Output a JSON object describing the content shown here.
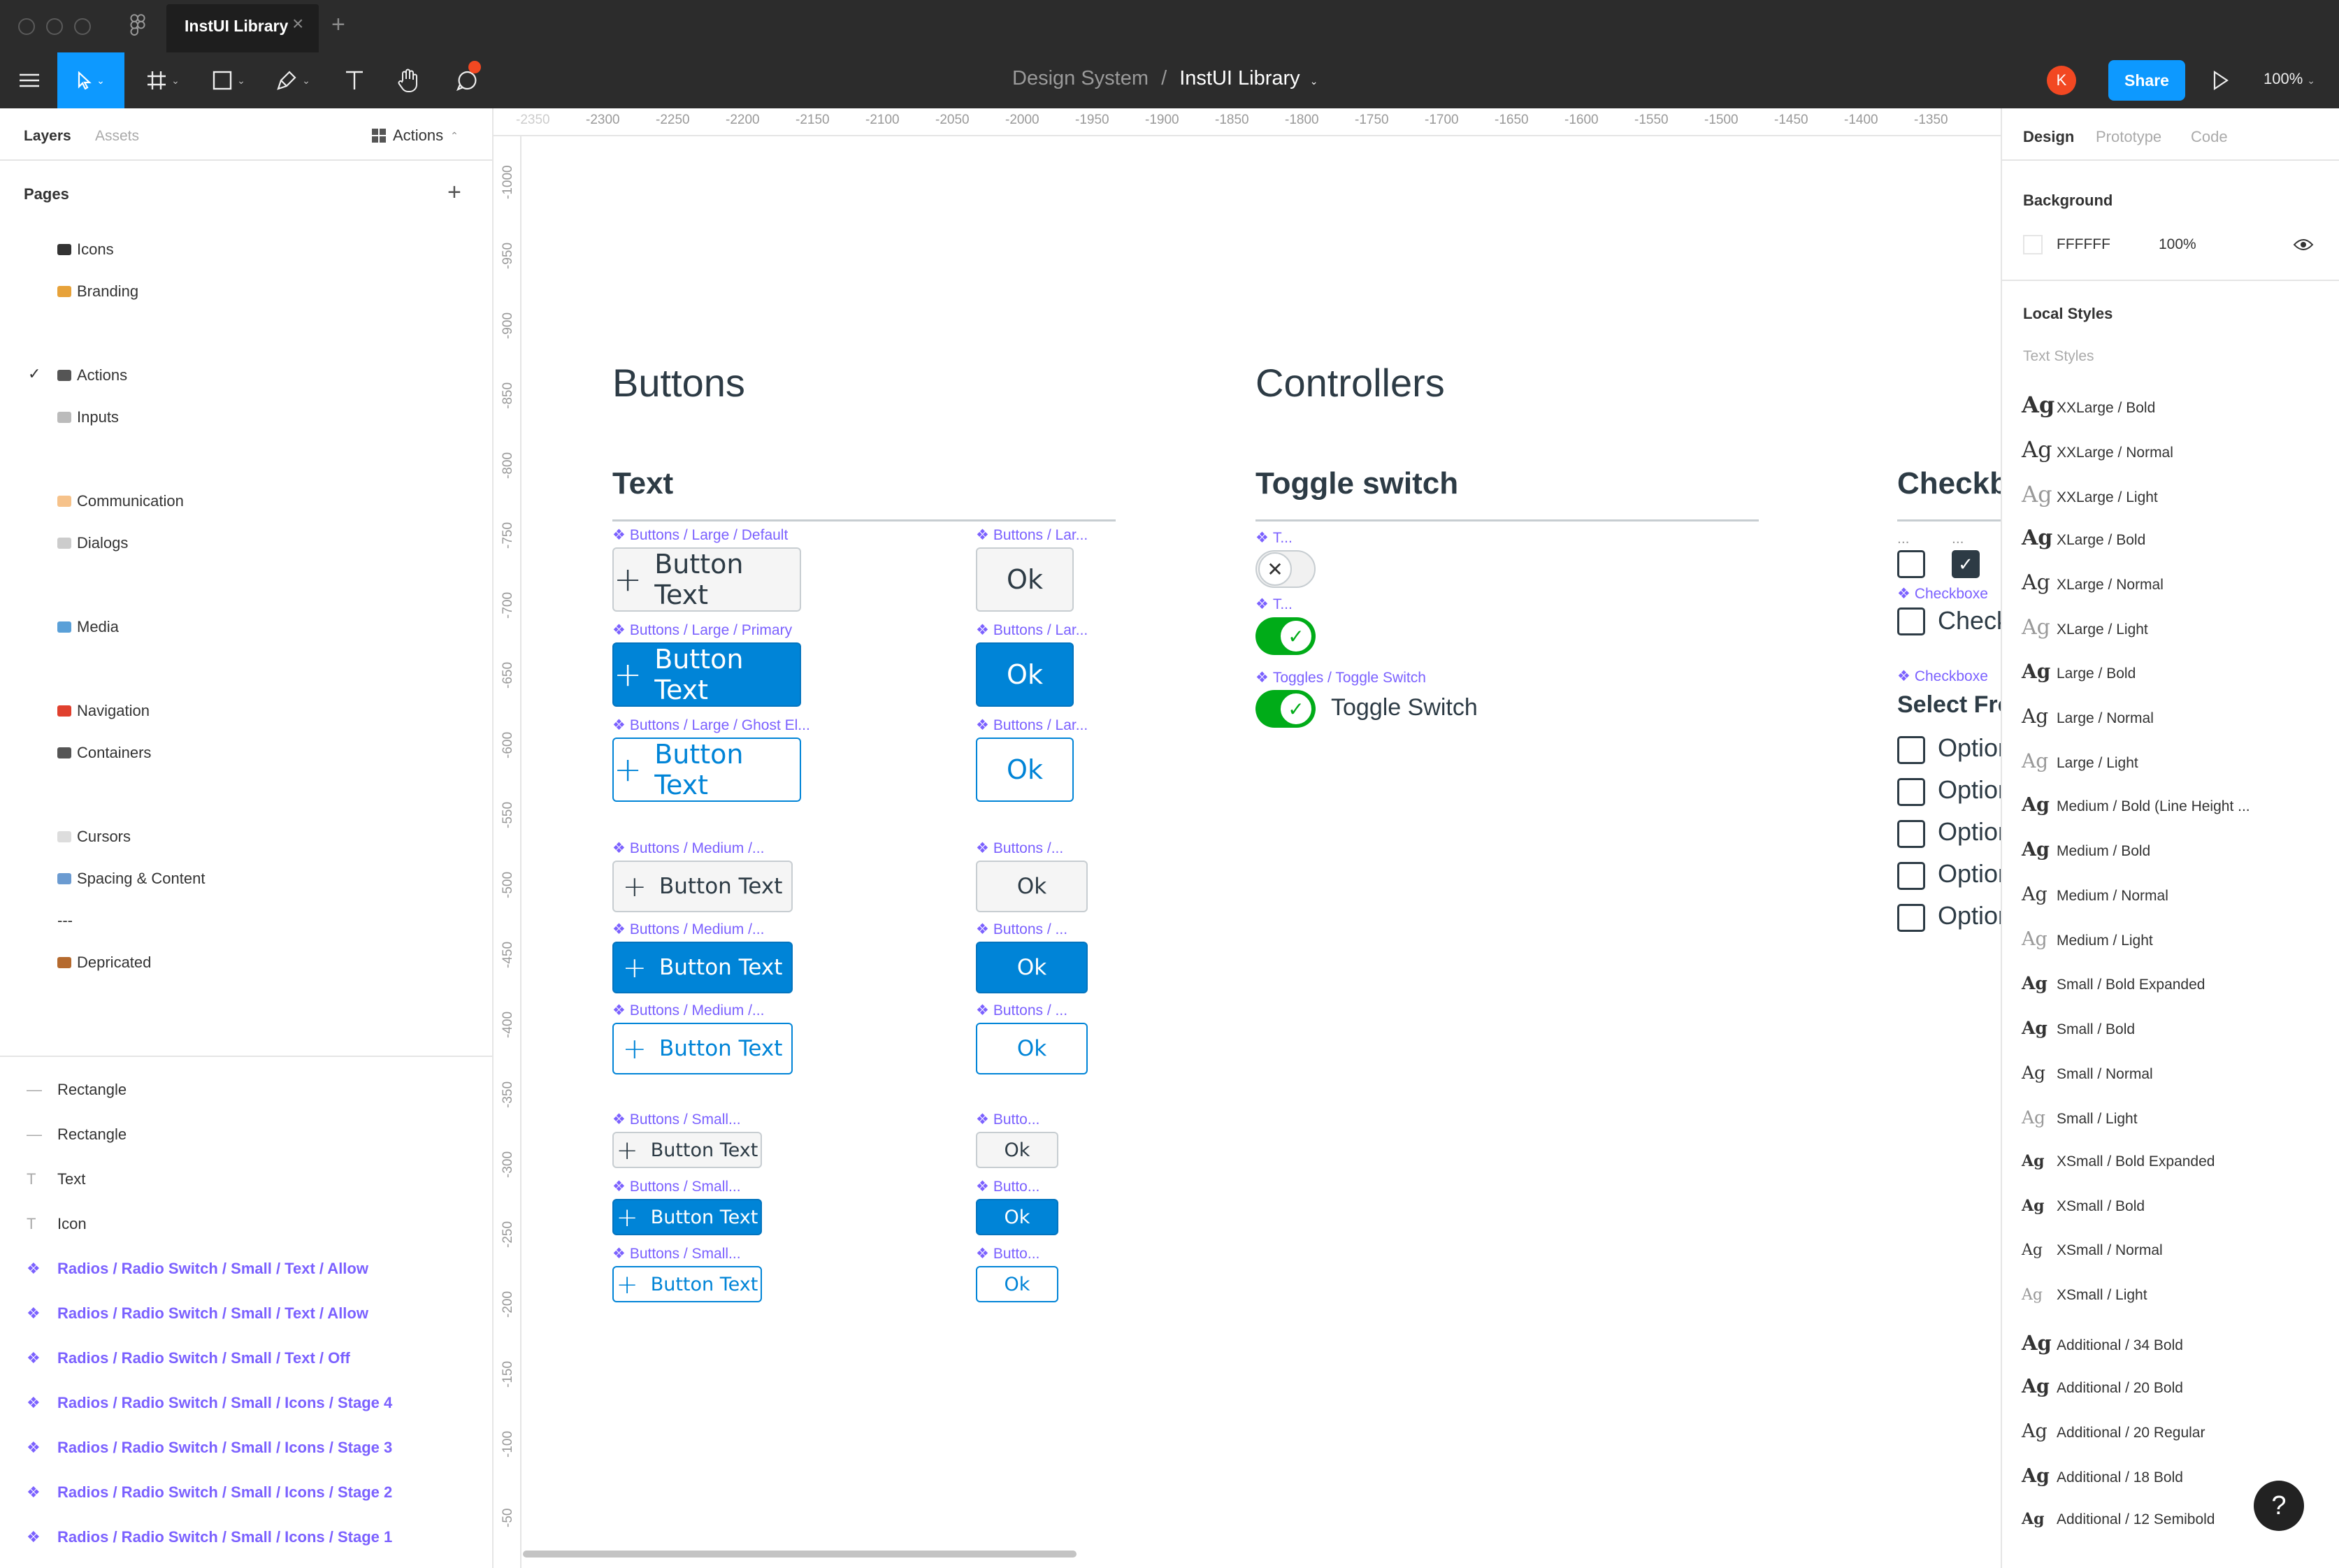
{
  "window": {
    "tab_title": "InstUI Library"
  },
  "toolbar": {
    "breadcrumb_parent": "Design System",
    "breadcrumb_sep": "/",
    "breadcrumb_current": "InstUI Library",
    "avatar_initial": "K",
    "share_label": "Share",
    "zoom": "100%"
  },
  "left_panel": {
    "tabs": {
      "layers": "Layers",
      "assets": "Assets"
    },
    "current_page_dropdown": "Actions",
    "pages_title": "Pages",
    "pages": [
      {
        "label": "Icons",
        "icon": "person-icon",
        "selected": false
      },
      {
        "label": "Branding",
        "icon": "paint-icon",
        "selected": false
      },
      {
        "label": "Actions",
        "icon": "grid-icon",
        "selected": true
      },
      {
        "label": "Inputs",
        "icon": "keyboard-icon",
        "selected": false
      },
      {
        "label": "Communication",
        "icon": "bubble-icon",
        "selected": false
      },
      {
        "label": "Dialogs",
        "icon": "speech-icon",
        "selected": false
      },
      {
        "label": "Media",
        "icon": "image-icon",
        "selected": false
      },
      {
        "label": "Navigation",
        "icon": "pin-icon",
        "selected": false
      },
      {
        "label": "Containers",
        "icon": "box-icon",
        "selected": false
      },
      {
        "label": "Cursors",
        "icon": "cursor-icon",
        "selected": false
      },
      {
        "label": "Spacing & Content",
        "icon": "ruler-icon",
        "selected": false
      },
      {
        "label": "---",
        "icon": "",
        "selected": false
      },
      {
        "label": "Depricated",
        "icon": "house-icon",
        "selected": false
      }
    ],
    "layers": [
      {
        "label": "Rectangle",
        "type": "line"
      },
      {
        "label": "Rectangle",
        "type": "line"
      },
      {
        "label": "Text",
        "type": "text"
      },
      {
        "label": "Icon",
        "type": "text"
      },
      {
        "label": "Radios / Radio Switch / Small / Text / Allow",
        "type": "component"
      },
      {
        "label": "Radios / Radio Switch / Small / Text / Allow",
        "type": "component"
      },
      {
        "label": "Radios / Radio Switch / Small / Text / Off",
        "type": "component"
      },
      {
        "label": "Radios / Radio Switch / Small / Icons / Stage 4",
        "type": "component"
      },
      {
        "label": "Radios / Radio Switch / Small / Icons / Stage 3",
        "type": "component"
      },
      {
        "label": "Radios / Radio Switch / Small / Icons / Stage 2",
        "type": "component"
      },
      {
        "label": "Radios / Radio Switch / Small / Icons / Stage 1",
        "type": "component"
      }
    ]
  },
  "rulers": {
    "h": [
      "-2350",
      "-2300",
      "-2250",
      "-2200",
      "-2150",
      "-2100",
      "-2050",
      "-2000",
      "-1950",
      "-1900",
      "-1850",
      "-1800",
      "-1750",
      "-1700",
      "-1650",
      "-1600",
      "-1550",
      "-1500",
      "-1450",
      "-1400",
      "-1350"
    ],
    "v": [
      "-1000",
      "-950",
      "-900",
      "-850",
      "-800",
      "-750",
      "-700",
      "-650",
      "-600",
      "-550",
      "-500",
      "-450",
      "-400",
      "-350",
      "-300",
      "-250",
      "-200",
      "-150",
      "-100",
      "-50"
    ]
  },
  "canvas": {
    "buttons_title": "Buttons",
    "text_subtitle": "Text",
    "controllers_title": "Controllers",
    "toggle_subtitle": "Toggle switch",
    "checkbox_subtitle": "Checkb",
    "button_rows": [
      {
        "label": "Buttons / Large / Default",
        "ok_label": "Buttons / Lar...",
        "text": "Button Text",
        "ok": "Ok"
      },
      {
        "label": "Buttons / Large / Primary",
        "ok_label": "Buttons / Lar...",
        "text": "Button Text",
        "ok": "Ok"
      },
      {
        "label": "Buttons / Large / Ghost El...",
        "ok_label": "Buttons / Lar...",
        "text": "Button Text",
        "ok": "Ok"
      },
      {
        "label": "Buttons / Medium /...",
        "ok_label": "Buttons /...",
        "text": "Button Text",
        "ok": "Ok"
      },
      {
        "label": "Buttons / Medium /...",
        "ok_label": "Buttons / ...",
        "text": "Button Text",
        "ok": "Ok"
      },
      {
        "label": "Buttons / Medium /...",
        "ok_label": "Buttons / ...",
        "text": "Button Text",
        "ok": "Ok"
      },
      {
        "label": "Buttons / Small...",
        "ok_label": "Butto...",
        "text": "Button Text",
        "ok": "Ok"
      },
      {
        "label": "Buttons / Small...",
        "ok_label": "Butto...",
        "text": "Button Text",
        "ok": "Ok"
      },
      {
        "label": "Buttons / Small...",
        "ok_label": "Butto...",
        "text": "Button Text",
        "ok": "Ok"
      }
    ],
    "toggles": {
      "label1": "T...",
      "label2": "T...",
      "label3": "Toggles / Toggle Switch",
      "toggle_text": "Toggle Switch"
    },
    "checkbox": {
      "dots1": "...",
      "dots2": "...",
      "label1": "Checkboxe",
      "check_text": "Check",
      "label2": "Checkboxe",
      "select_title": "Select Fron",
      "options": [
        "Option",
        "Option",
        "Option",
        "Option",
        "Option"
      ]
    }
  },
  "right_panel": {
    "tabs": {
      "design": "Design",
      "prototype": "Prototype",
      "code": "Code"
    },
    "background_title": "Background",
    "bg_hex": "FFFFFF",
    "bg_opacity": "100%",
    "local_styles_title": "Local Styles",
    "text_styles_title": "Text Styles",
    "ag": "Ag",
    "styles": [
      {
        "name": "XXLarge / Bold",
        "w": "bold",
        "s": 32
      },
      {
        "name": "XXLarge / Normal",
        "w": "normal",
        "s": 32
      },
      {
        "name": "XXLarge / Light",
        "w": "light",
        "s": 32
      },
      {
        "name": "XLarge / Bold",
        "w": "bold",
        "s": 30
      },
      {
        "name": "XLarge / Normal",
        "w": "normal",
        "s": 30
      },
      {
        "name": "XLarge / Light",
        "w": "light",
        "s": 30
      },
      {
        "name": "Large / Bold",
        "w": "bold",
        "s": 28
      },
      {
        "name": "Large / Normal",
        "w": "normal",
        "s": 28
      },
      {
        "name": "Large / Light",
        "w": "light",
        "s": 28
      },
      {
        "name": "Medium / Bold (Line Height ...",
        "w": "bold",
        "s": 27
      },
      {
        "name": "Medium / Bold",
        "w": "bold",
        "s": 27
      },
      {
        "name": "Medium / Normal",
        "w": "normal",
        "s": 27
      },
      {
        "name": "Medium / Light",
        "w": "light",
        "s": 27
      },
      {
        "name": "Small / Bold Expanded",
        "w": "bold",
        "s": 25
      },
      {
        "name": "Small / Bold",
        "w": "bold",
        "s": 25
      },
      {
        "name": "Small / Normal",
        "w": "normal",
        "s": 25
      },
      {
        "name": "Small / Light",
        "w": "light",
        "s": 25
      },
      {
        "name": "XSmall / Bold Expanded",
        "w": "bold",
        "s": 22
      },
      {
        "name": "XSmall / Bold",
        "w": "bold",
        "s": 22
      },
      {
        "name": "XSmall / Normal",
        "w": "normal",
        "s": 22
      },
      {
        "name": "XSmall / Light",
        "w": "light",
        "s": 22
      },
      {
        "name": "Additional / 34 Bold",
        "w": "bold",
        "s": 29
      },
      {
        "name": "Additional / 20 Bold",
        "w": "bold",
        "s": 27
      },
      {
        "name": "Additional / 20 Regular",
        "w": "normal",
        "s": 27
      },
      {
        "name": "Additional / 18 Bold",
        "w": "bold",
        "s": 27
      },
      {
        "name": "Additional / 12 Semibold",
        "w": "bold",
        "s": 22
      }
    ],
    "help": "?"
  }
}
